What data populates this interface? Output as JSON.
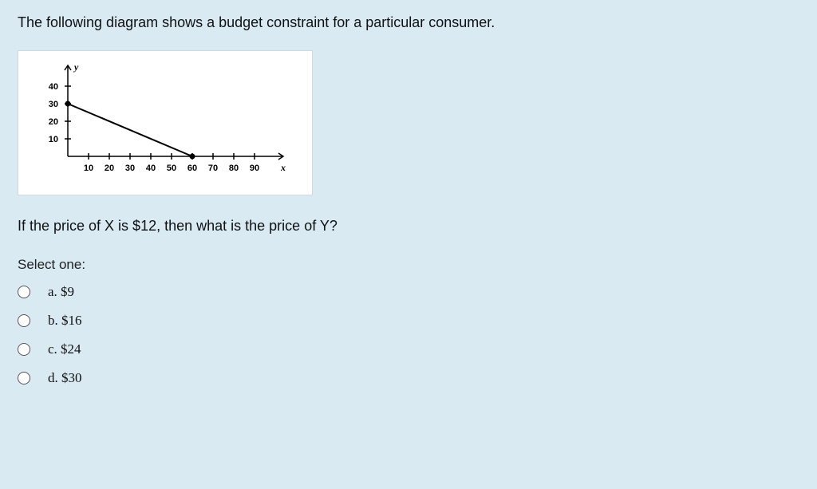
{
  "question": {
    "intro": "The following diagram shows a budget constraint for a particular consumer.",
    "followup": "If the price of X is $12, then what is the price of Y?",
    "select_label": "Select one:"
  },
  "options": [
    {
      "label": "a. $9"
    },
    {
      "label": "b. $16"
    },
    {
      "label": "c. $24"
    },
    {
      "label": "d. $30"
    }
  ],
  "chart_data": {
    "type": "line",
    "title": "",
    "xlabel": "x",
    "ylabel": "y",
    "x_ticks": [
      10,
      20,
      30,
      40,
      50,
      60,
      70,
      80,
      90
    ],
    "y_ticks": [
      10,
      20,
      30,
      40
    ],
    "xlim": [
      0,
      100
    ],
    "ylim": [
      0,
      50
    ],
    "series": [
      {
        "name": "budget_constraint",
        "x": [
          0,
          60
        ],
        "y": [
          30,
          0
        ]
      }
    ],
    "points": [
      {
        "x": 0,
        "y": 30
      },
      {
        "x": 60,
        "y": 0
      }
    ]
  }
}
